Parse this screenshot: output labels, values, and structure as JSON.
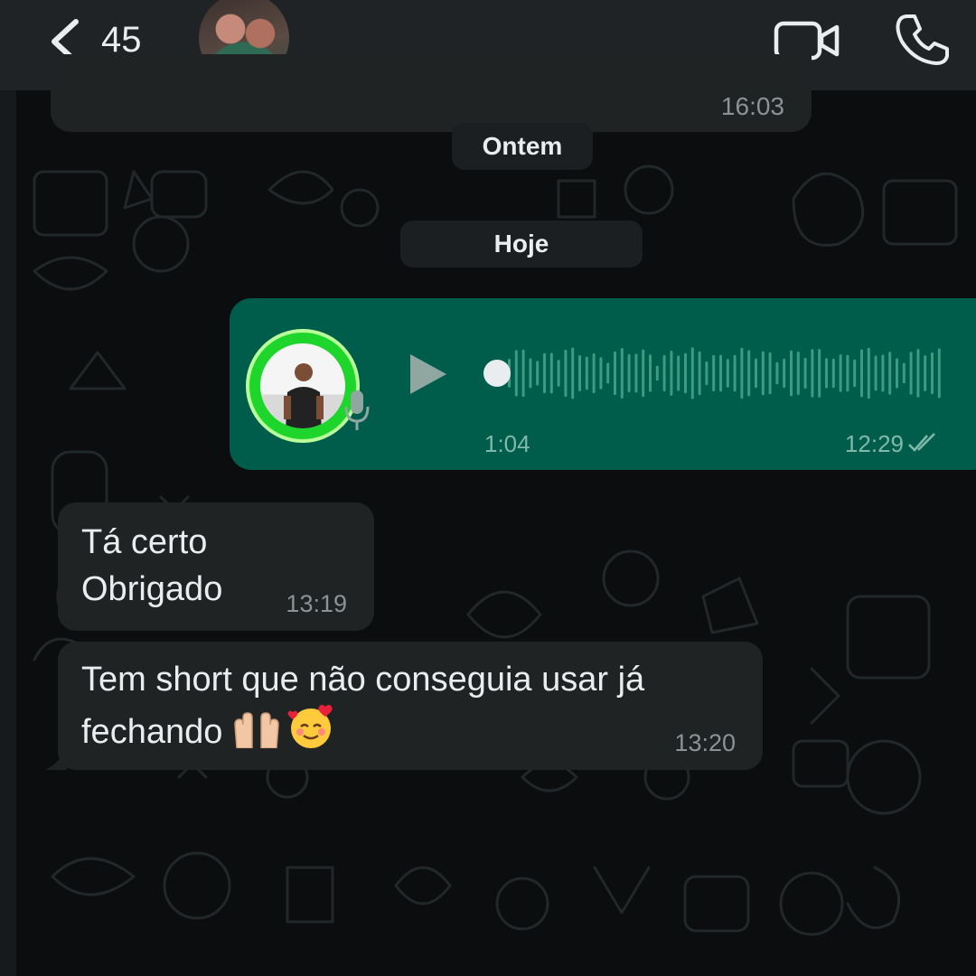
{
  "header": {
    "unread_count": "45",
    "icons": {
      "back": "chevron-left-icon",
      "video": "video-camera-icon",
      "call": "phone-icon"
    }
  },
  "conversation": {
    "previous_message_time": "16:03",
    "date_dividers": [
      "Ontem",
      "Hoje"
    ],
    "voice_message": {
      "duration": "1:04",
      "time": "12:29",
      "status": "read",
      "progress": 0
    },
    "messages": [
      {
        "text": "Tá certo\nObrigado",
        "time": "13:19"
      },
      {
        "text": "Tem short que não conseguia usar já\nfechando",
        "emoji": "🙌🏼🥰",
        "time": "13:20"
      }
    ]
  },
  "colors": {
    "header_bg": "#1f2325",
    "wallpaper_bg": "#0b0d0e",
    "incoming_bubble": "#1f2324",
    "outgoing_bubble": "#005c4b",
    "meta_text": "#8a9396",
    "voice_meta_text": "#7fb9a9",
    "avatar_ring": "#1dd52b"
  }
}
